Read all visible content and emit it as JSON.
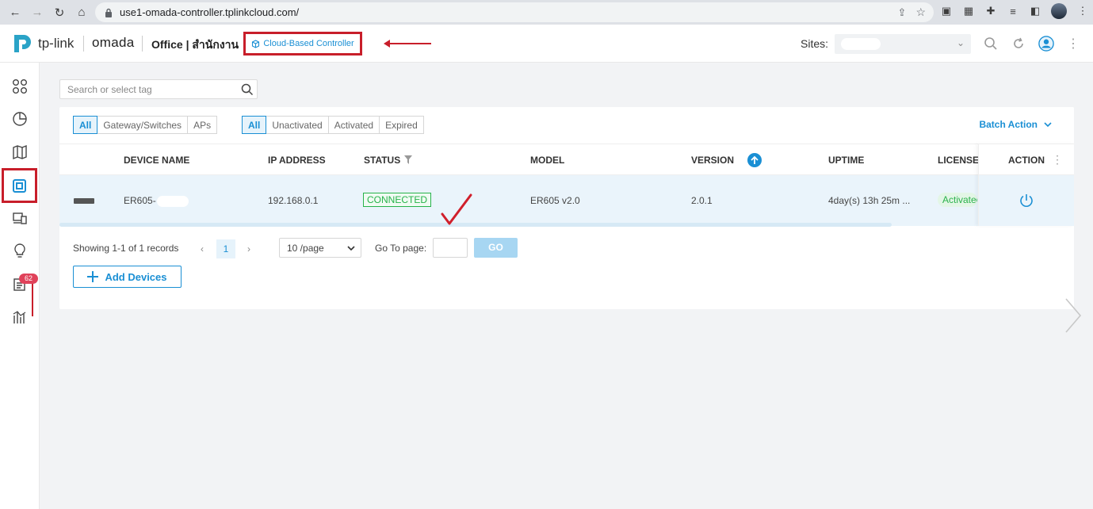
{
  "browser": {
    "url": "use1-omada-controller.tplinkcloud.com/"
  },
  "header": {
    "brand": "tp-link",
    "product": "omada",
    "site_title": "Office | สำนักงาน",
    "controller_badge": "Cloud-Based Controller",
    "sites_label": "Sites:"
  },
  "search": {
    "placeholder": "Search or select tag"
  },
  "filters": {
    "type": [
      "All",
      "Gateway/Switches",
      "APs"
    ],
    "activation": [
      "All",
      "Unactivated",
      "Activated",
      "Expired"
    ]
  },
  "batch_action": "Batch Action",
  "table": {
    "headers": {
      "device_name": "DEVICE NAME",
      "ip": "IP ADDRESS",
      "status": "STATUS",
      "model": "MODEL",
      "version": "VERSION",
      "uptime": "UPTIME",
      "license": "LICENSE",
      "action": "ACTION"
    },
    "rows": [
      {
        "device_name": "ER605-",
        "ip": "192.168.0.1",
        "status": "CONNECTED",
        "model": "ER605 v2.0",
        "version": "2.0.1",
        "uptime": "4day(s) 13h 25m ...",
        "license": "Activated"
      }
    ]
  },
  "pagination": {
    "summary": "Showing 1-1 of 1 records",
    "current_page": "1",
    "page_size": "10 /page",
    "goto_label": "Go To page:",
    "go_button": "GO"
  },
  "add_devices": "Add Devices",
  "sidebar": {
    "alerts_badge": "62"
  },
  "colors": {
    "accent": "#1a8fd4",
    "success": "#27b34a",
    "annotation": "#c81e2a"
  }
}
